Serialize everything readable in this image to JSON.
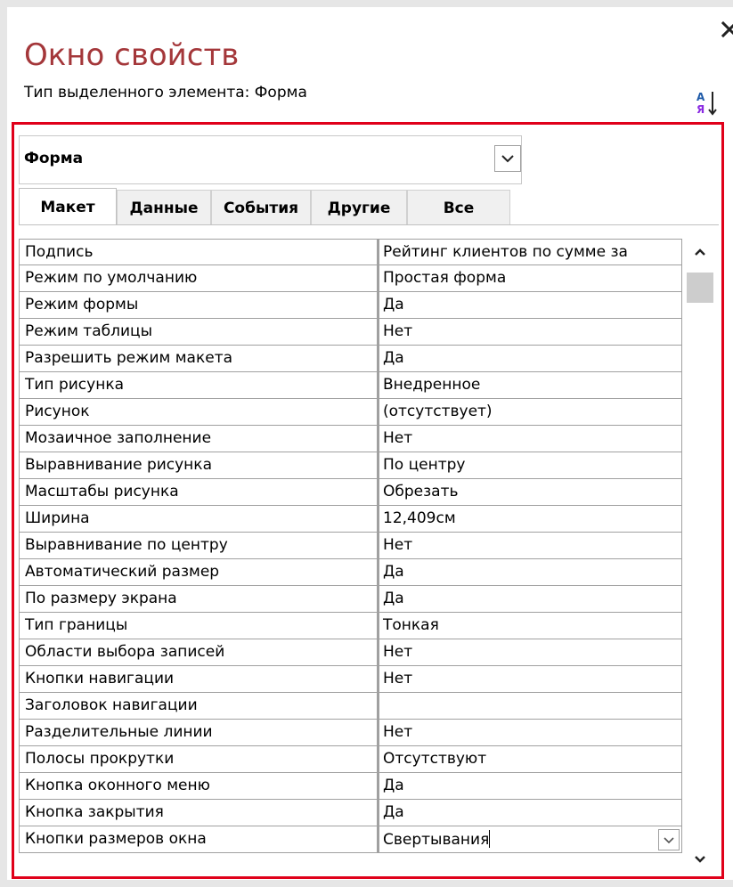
{
  "window": {
    "title": "Окно свойств",
    "subtitle": "Тип выделенного элемента:  Форма"
  },
  "selector": {
    "value": "Форма"
  },
  "tabs": [
    {
      "label": "Макет",
      "active": true
    },
    {
      "label": "Данные",
      "active": false
    },
    {
      "label": "События",
      "active": false
    },
    {
      "label": "Другие",
      "active": false
    },
    {
      "label": "Все",
      "active": false
    }
  ],
  "properties": [
    {
      "name": "Подпись",
      "value": "Рейтинг клиентов по сумме за"
    },
    {
      "name": "Режим по умолчанию",
      "value": "Простая форма"
    },
    {
      "name": "Режим формы",
      "value": "Да"
    },
    {
      "name": "Режим таблицы",
      "value": "Нет"
    },
    {
      "name": "Разрешить режим макета",
      "value": "Да"
    },
    {
      "name": "Тип рисунка",
      "value": "Внедренное"
    },
    {
      "name": "Рисунок",
      "value": "(отсутствует)"
    },
    {
      "name": "Мозаичное заполнение",
      "value": "Нет"
    },
    {
      "name": "Выравнивание рисунка",
      "value": "По центру"
    },
    {
      "name": "Масштабы рисунка",
      "value": "Обрезать"
    },
    {
      "name": "Ширина",
      "value": "12,409см"
    },
    {
      "name": "Выравнивание по центру",
      "value": "Нет"
    },
    {
      "name": "Автоматический размер",
      "value": "Да"
    },
    {
      "name": "По размеру экрана",
      "value": "Да"
    },
    {
      "name": "Тип границы",
      "value": "Тонкая"
    },
    {
      "name": "Области выбора записей",
      "value": "Нет"
    },
    {
      "name": "Кнопки навигации",
      "value": "Нет"
    },
    {
      "name": "Заголовок навигации",
      "value": ""
    },
    {
      "name": "Разделительные линии",
      "value": "Нет"
    },
    {
      "name": "Полосы прокрутки",
      "value": "Отсутствуют"
    },
    {
      "name": "Кнопка оконного меню",
      "value": "Да"
    },
    {
      "name": "Кнопка закрытия",
      "value": "Да"
    },
    {
      "name": "Кнопки размеров окна",
      "value": "Свертывания"
    }
  ],
  "icons": {
    "close": "close-icon",
    "sort": "sort-az-icon",
    "dropdown": "chevron-down-icon",
    "scroll_up": "scroll-up-icon",
    "scroll_down": "scroll-down-icon"
  },
  "colors": {
    "title": "#a4373a",
    "highlight_frame": "#e0001a",
    "sort_blue": "#1e5aa8",
    "sort_purple": "#8a2be2"
  }
}
